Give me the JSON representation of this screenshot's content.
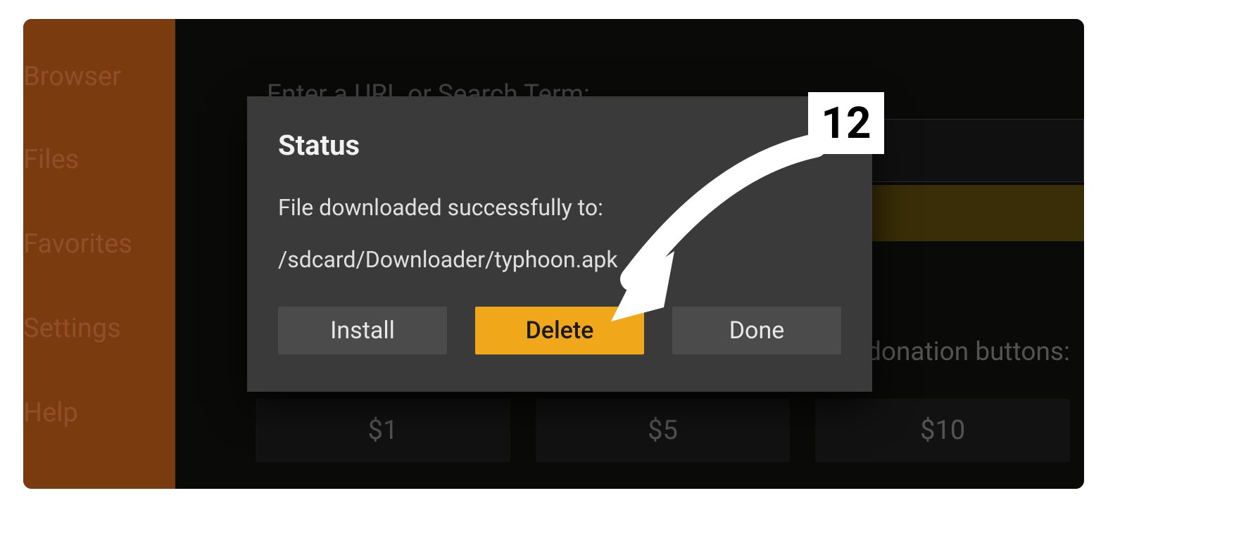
{
  "sidebar": {
    "items": [
      {
        "label": "Browser"
      },
      {
        "label": "Files"
      },
      {
        "label": "Favorites"
      },
      {
        "label": "Settings"
      },
      {
        "label": "Help"
      }
    ]
  },
  "main": {
    "url_prompt": "Enter a URL or Search Term:",
    "donation_prompt": "se donation buttons:",
    "donation_buttons": [
      "$1",
      "$5",
      "$10"
    ]
  },
  "dialog": {
    "title": "Status",
    "line1": "File downloaded successfully to:",
    "line2": "/sdcard/Downloader/typhoon.apk",
    "buttons": {
      "install": "Install",
      "delete": "Delete",
      "done": "Done"
    }
  },
  "callout": {
    "step": "12"
  }
}
